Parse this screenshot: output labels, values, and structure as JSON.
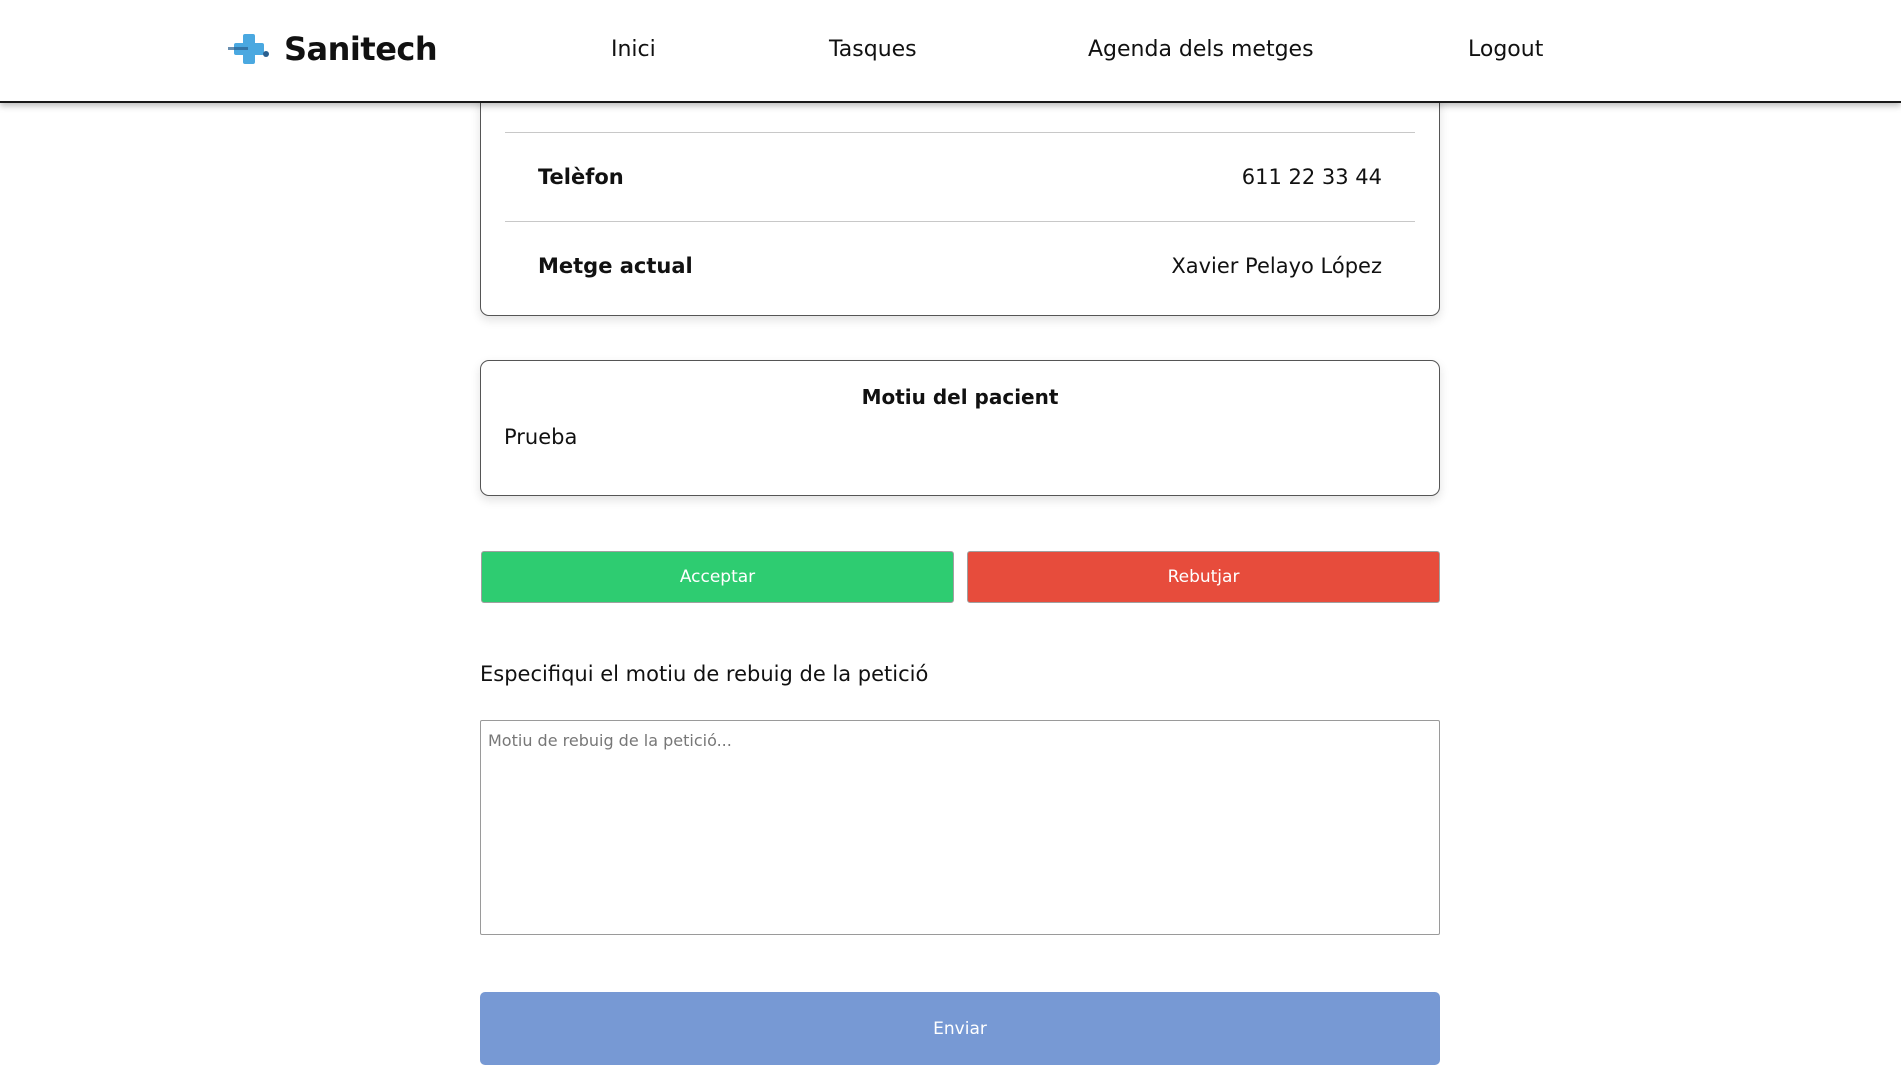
{
  "navbar": {
    "brand": "Sanitech",
    "links": [
      "Inici",
      "Tasques",
      "Agenda dels metges",
      "Logout"
    ]
  },
  "patient_info": {
    "rows": [
      {
        "label": "Telèfon",
        "value": "611 22 33 44"
      },
      {
        "label": "Metge actual",
        "value": "Xavier Pelayo López"
      }
    ]
  },
  "reason": {
    "title": "Motiu del pacient",
    "text": "Prueba"
  },
  "actions": {
    "accept_label": "Acceptar",
    "reject_label": "Rebutjar"
  },
  "rejection": {
    "label": "Especifiqui el motiu de rebuig de la petició",
    "placeholder": "Motiu de rebuig de la petició...",
    "value": ""
  },
  "send_label": "Enviar",
  "colors": {
    "accept": "#2ecc71",
    "reject": "#e74c3c",
    "send": "#7799d4",
    "logo_cross": "#4aa8e0"
  },
  "icons": {
    "logo": "medical-cross-icon"
  }
}
